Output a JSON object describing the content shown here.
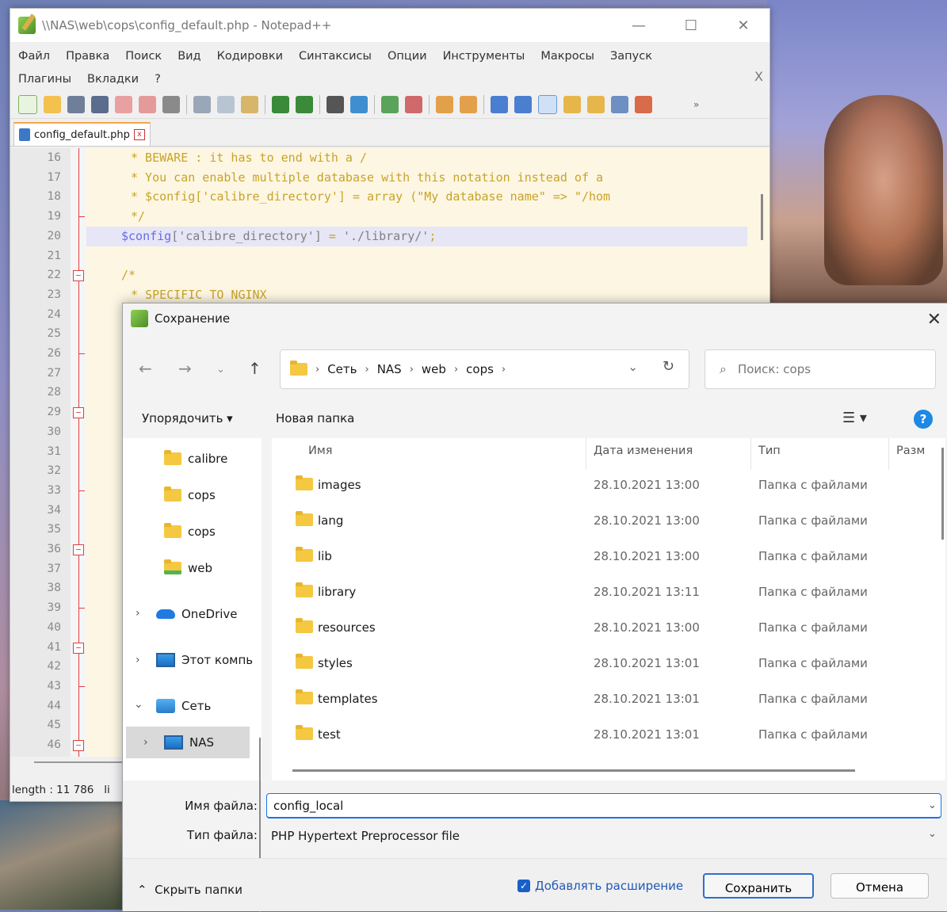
{
  "npp": {
    "title": "\\\\NAS\\web\\cops\\config_default.php - Notepad++",
    "window_controls": [
      "—",
      "☐",
      "✕"
    ],
    "menu": [
      "Файл",
      "Правка",
      "Поиск",
      "Вид",
      "Кодировки",
      "Синтаксисы",
      "Опции",
      "Инструменты",
      "Макросы",
      "Запуск",
      "Плагины",
      "Вкладки",
      "?"
    ],
    "menu_close": "X",
    "tab_label": "config_default.php",
    "line_numbers": [
      "16",
      "17",
      "18",
      "19",
      "20",
      "21",
      "22",
      "23",
      "24",
      "25",
      "26",
      "27",
      "28",
      "29",
      "30",
      "31",
      "32",
      "33",
      "34",
      "35",
      "36",
      "37",
      "38",
      "39",
      "40",
      "41",
      "42",
      "43",
      "44",
      "45",
      "46"
    ],
    "code": {
      "l16": "* BEWARE : it has to end with a /",
      "l17": "* You can enable multiple database with this notation instead of a",
      "l18": "* $config['calibre_directory'] = array (\"My database name\" => \"/hom",
      "l19": "*/",
      "l20_var": "$config",
      "l20_key": "['calibre_directory']",
      "l20_op": " = ",
      "l20_val": "'./library/'",
      "l20_end": ";",
      "l22": "/*",
      "l23": "* SPECIFIC TO NGINX"
    },
    "status": "length : 11 786",
    "status_tail": "li"
  },
  "dialog": {
    "title": "Сохранение",
    "breadcrumbs": [
      "Сеть",
      "NAS",
      "web",
      "cops"
    ],
    "search_placeholder": "Поиск: cops",
    "organize": "Упорядочить ▾",
    "new_folder": "Новая папка",
    "nav": [
      {
        "label": "calibre"
      },
      {
        "label": "cops"
      },
      {
        "label": "cops"
      },
      {
        "label": "web"
      },
      {
        "label": "OneDrive"
      },
      {
        "label": "Этот компь"
      },
      {
        "label": "Сеть"
      },
      {
        "label": "NAS"
      }
    ],
    "columns": [
      "Имя",
      "Дата изменения",
      "Тип",
      "Разм"
    ],
    "files": [
      {
        "name": "images",
        "date": "28.10.2021 13:00",
        "type": "Папка с файлами"
      },
      {
        "name": "lang",
        "date": "28.10.2021 13:00",
        "type": "Папка с файлами"
      },
      {
        "name": "lib",
        "date": "28.10.2021 13:00",
        "type": "Папка с файлами"
      },
      {
        "name": "library",
        "date": "28.10.2021 13:11",
        "type": "Папка с файлами"
      },
      {
        "name": "resources",
        "date": "28.10.2021 13:00",
        "type": "Папка с файлами"
      },
      {
        "name": "styles",
        "date": "28.10.2021 13:01",
        "type": "Папка с файлами"
      },
      {
        "name": "templates",
        "date": "28.10.2021 13:01",
        "type": "Папка с файлами"
      },
      {
        "name": "test",
        "date": "28.10.2021 13:01",
        "type": "Папка с файлами"
      }
    ],
    "filename_label": "Имя файла:",
    "filename_value": "config_local",
    "filetype_label": "Тип файла:",
    "filetype_value": "PHP Hypertext Preprocessor file",
    "hide_folders": "Скрыть папки",
    "add_extension": "Добавлять расширение",
    "save": "Сохранить",
    "cancel": "Отмена"
  }
}
